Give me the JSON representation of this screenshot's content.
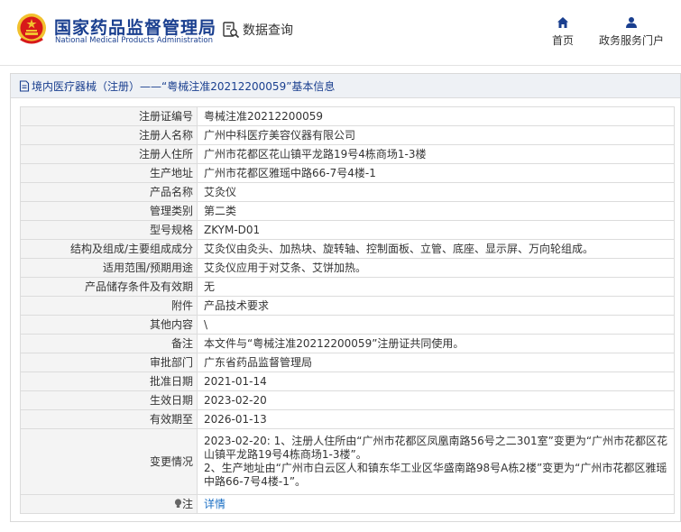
{
  "header": {
    "logo_cn": "国家药品监督管理局",
    "logo_en": "National Medical Products Administration",
    "db_query_label": "数据查询",
    "nav": [
      {
        "icon": "home-icon",
        "label": "首页"
      },
      {
        "icon": "user-icon",
        "label": "政务服务门户"
      }
    ]
  },
  "panel": {
    "title": "境内医疗器械（注册）——“粤械注准20212200059”基本信息"
  },
  "rows": [
    {
      "key": "注册证编号",
      "value": "粤械注准20212200059"
    },
    {
      "key": "注册人名称",
      "value": "广州中科医疗美容仪器有限公司"
    },
    {
      "key": "注册人住所",
      "value": "广州市花都区花山镇平龙路19号4栋商场1-3楼"
    },
    {
      "key": "生产地址",
      "value": "广州市花都区雅瑶中路66-7号4楼-1"
    },
    {
      "key": "产品名称",
      "value": "艾灸仪"
    },
    {
      "key": "管理类别",
      "value": "第二类"
    },
    {
      "key": "型号规格",
      "value": "ZKYM-D01"
    },
    {
      "key": "结构及组成/主要组成成分",
      "value": "艾灸仪由灸头、加热块、旋转轴、控制面板、立管、底座、显示屏、万向轮组成。"
    },
    {
      "key": "适用范围/预期用途",
      "value": "艾灸仪应用于对艾条、艾饼加热。"
    },
    {
      "key": "产品储存条件及有效期",
      "value": "无"
    },
    {
      "key": "附件",
      "value": "产品技术要求"
    },
    {
      "key": "其他内容",
      "value": "\\"
    },
    {
      "key": "备注",
      "value": "本文件与“粤械注准20212200059”注册证共同使用。"
    },
    {
      "key": "审批部门",
      "value": "广东省药品监督管理局"
    },
    {
      "key": "批准日期",
      "value": "2021-01-14"
    },
    {
      "key": "生效日期",
      "value": "2023-02-20"
    },
    {
      "key": "有效期至",
      "value": "2026-01-13"
    }
  ],
  "change": {
    "key": "变更情况",
    "line1": "2023-02-20: 1、注册人住所由“广州市花都区凤凰南路56号之二301室”变更为“广州市花都区花山镇平龙路19号4栋商场1-3楼”。",
    "line2": "2、生产地址由“广州市白云区人和镇东华工业区华盛南路98号A栋2楼”变更为“广州市花都区雅瑶中路66-7号4楼-1”。"
  },
  "note": {
    "icon": "bulb-icon",
    "key": "注",
    "link_label": "详情"
  },
  "colors": {
    "brand_blue": "#1a3f8f",
    "link_blue": "#1a6fc4",
    "emblem_red": "#d7191a",
    "emblem_gold": "#f2c12e"
  }
}
